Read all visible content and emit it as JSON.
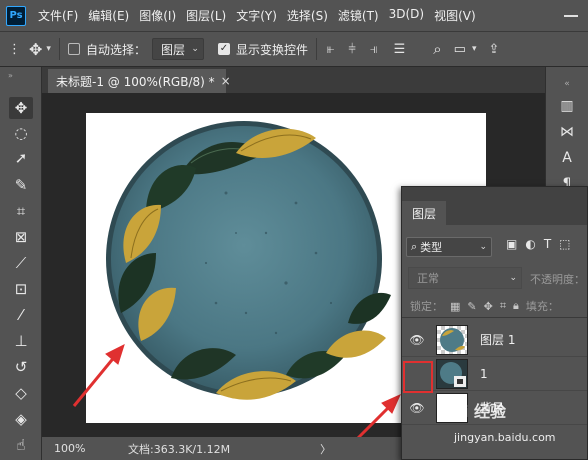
{
  "app": {
    "logo_text": "Ps"
  },
  "menu": [
    "文件(F)",
    "编辑(E)",
    "图像(I)",
    "图层(L)",
    "文字(Y)",
    "选择(S)",
    "滤镜(T)",
    "3D(D)",
    "视图(V)"
  ],
  "options_bar": {
    "auto_select_label": "自动选择：",
    "auto_select_checked": false,
    "target_value": "图层",
    "show_transform_label": "显示变换控件",
    "show_transform_checked": true
  },
  "document_tab": {
    "title": "未标题-1 @ 100%(RGB/8) *",
    "close": "×"
  },
  "status_bar": {
    "zoom": "100%",
    "doc_info": "文档:363.3K/1.12M",
    "chevron": "〉"
  },
  "layers_panel": {
    "tab_label": "图层",
    "filter_label": "类型",
    "blend_mode": "正常",
    "opacity_label": "不透明度：",
    "lock_label": "锁定：",
    "fill_label": "填充：",
    "layers": [
      {
        "name": "图层 1",
        "visible": true
      },
      {
        "name": "1",
        "visible": false
      },
      {
        "name": "背景",
        "visible": true
      }
    ]
  },
  "watermark": {
    "main": "Bai 经验",
    "sub": "jingyan.baidu.com"
  },
  "colors": {
    "panel_bg": "#535353",
    "canvas_bg": "#282828",
    "plate": "#4e7b87",
    "leaf_yellow": "#c9a43a",
    "leaf_green": "#233a2a",
    "annotation_red": "#e03030"
  }
}
